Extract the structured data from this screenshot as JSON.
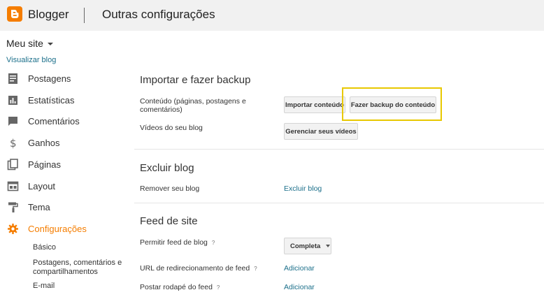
{
  "header": {
    "brand": "Blogger",
    "page_title": "Outras configurações",
    "accent_color": "#f57d00"
  },
  "sidebar": {
    "site_name": "Meu site",
    "view_blog": "Visualizar blog",
    "items": [
      {
        "label": "Postagens",
        "icon": "posts-icon"
      },
      {
        "label": "Estatísticas",
        "icon": "stats-icon"
      },
      {
        "label": "Comentários",
        "icon": "comments-icon"
      },
      {
        "label": "Ganhos",
        "icon": "dollar-icon"
      },
      {
        "label": "Páginas",
        "icon": "pages-icon"
      },
      {
        "label": "Layout",
        "icon": "layout-icon"
      },
      {
        "label": "Tema",
        "icon": "paint-roller-icon"
      },
      {
        "label": "Configurações",
        "icon": "gear-icon",
        "active": true
      }
    ],
    "sub_items": [
      {
        "label": "Básico"
      },
      {
        "label": "Postagens, comentários e compartilhamentos"
      },
      {
        "label": "E-mail"
      }
    ]
  },
  "main": {
    "import_backup": {
      "title": "Importar e fazer backup",
      "content_label": "Conteúdo (páginas, postagens e comentários)",
      "import_button": "Importar conteúdo",
      "backup_button": "Fazer backup do conteúdo",
      "videos_label": "Vídeos do seu blog",
      "manage_videos_button": "Gerenciar seus vídeos"
    },
    "delete_blog": {
      "title": "Excluir blog",
      "remove_label": "Remover seu blog",
      "delete_link": "Excluir blog"
    },
    "site_feed": {
      "title": "Feed de site",
      "allow_feed_label": "Permitir feed de blog",
      "allow_feed_value": "Completa",
      "redirect_label": "URL de redirecionamento de feed",
      "redirect_link": "Adicionar",
      "footer_label": "Postar rodapé do feed",
      "footer_link": "Adicionar",
      "help": "?"
    }
  }
}
